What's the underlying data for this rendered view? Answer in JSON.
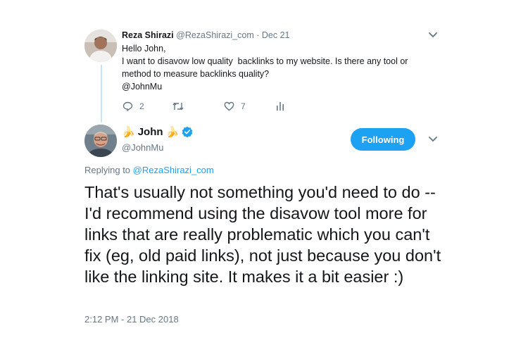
{
  "original_tweet": {
    "display_name": "Reza Shirazi",
    "handle": "@RezaShirazi_com",
    "separator": " · ",
    "date": "Dec 21",
    "lines": [
      "Hello John,",
      "I want to disavow low quality  backlinks to my website. Is there any tool or",
      "method to measure backlinks quality?"
    ],
    "mention": "@JohnMu",
    "actions": {
      "reply_count": "2",
      "retweet_count": "",
      "like_count": "7"
    }
  },
  "reply_tweet": {
    "display_name": "John",
    "name_emoji_left": "🍌",
    "name_emoji_right": "🍌",
    "handle": "@JohnMu",
    "verified": true,
    "follow_label": "Following",
    "replying_prefix": "Replying to ",
    "replying_handle": "@RezaShirazi_com",
    "text": "That's usually not something you'd need to do -- I'd recommend using the disavow tool more for links that are really problematic which you can't fix (eg, old paid links), not just because you don't like the linking site. It makes it a bit easier :)",
    "timestamp": "2:12 PM - 21 Dec 2018"
  },
  "colors": {
    "accent": "#1da1f2",
    "muted": "#657786",
    "text": "#14171a",
    "thread_line": "#c8e4f8"
  },
  "icons": [
    "reply-icon",
    "retweet-icon",
    "like-icon",
    "analytics-icon",
    "chevron-down-icon",
    "verified-badge-icon",
    "banana-icon"
  ]
}
